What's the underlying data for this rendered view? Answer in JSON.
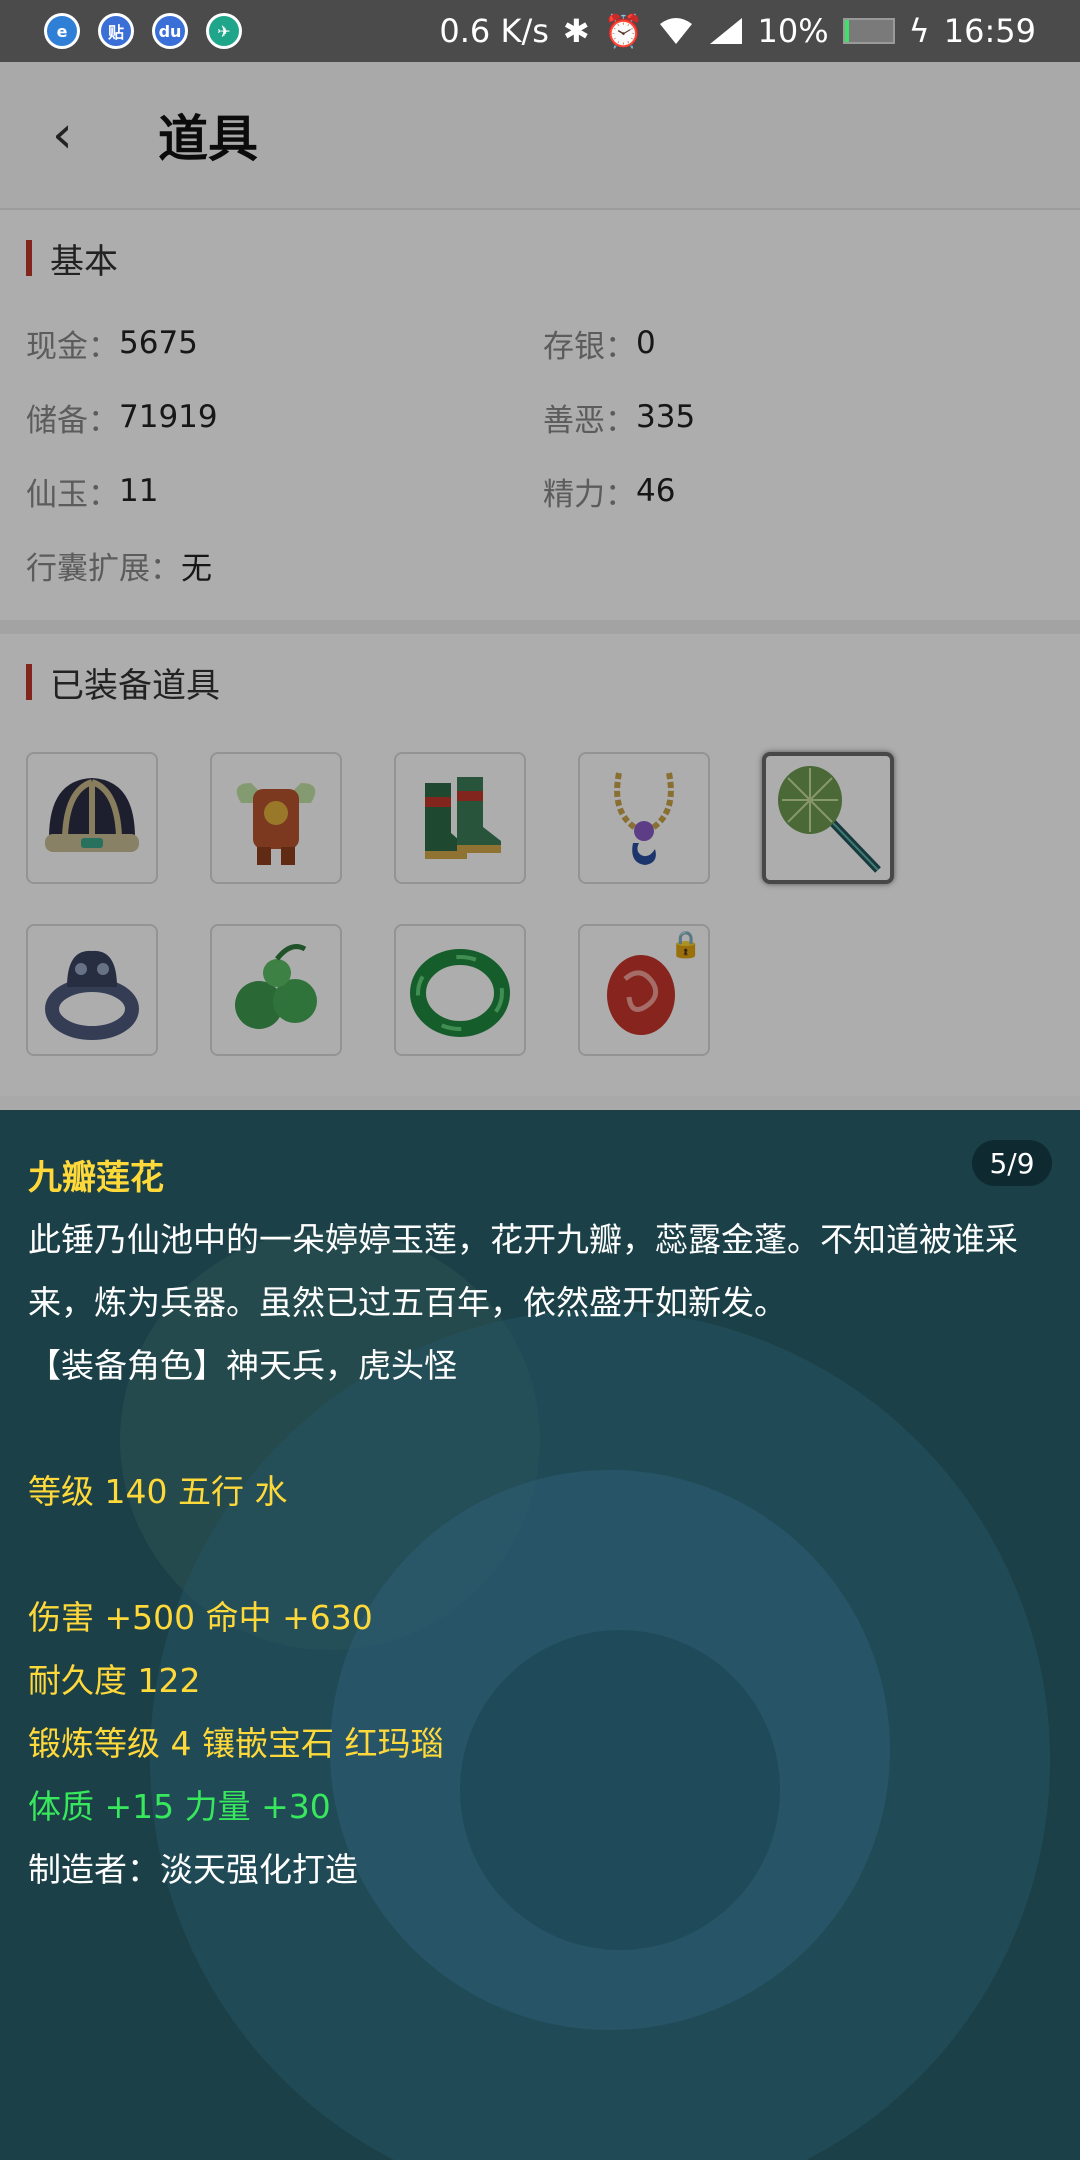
{
  "status_bar": {
    "net_speed": "0.6 K/s",
    "battery": "10%",
    "time": "16:59",
    "battery_level": 0.1,
    "app_badges": [
      "e",
      "贴",
      "du",
      "✈"
    ]
  },
  "header": {
    "title": "道具"
  },
  "basic": {
    "section_title": "基本",
    "cash_label": "现金：",
    "cash_value": "5675",
    "deposit_label": "存银：",
    "deposit_value": "0",
    "reserve_label": "储备：",
    "reserve_value": "71919",
    "karma_label": "善恶：",
    "karma_value": "335",
    "jade_label": "仙玉：",
    "jade_value": "11",
    "energy_label": "精力：",
    "energy_value": "46",
    "bag_label": "行囊扩展：",
    "bag_value": "无"
  },
  "equipped": {
    "section_title": "已装备道具",
    "items": [
      "helmet-icon",
      "armor-icon",
      "boots-icon",
      "necklace-icon",
      "lotus-hammer-icon",
      "ring-icon",
      "gourd-icon",
      "jade-bracelet-icon",
      "red-agate-icon"
    ],
    "selected_index": 4
  },
  "detail": {
    "name": "九瓣莲花",
    "pager": "5/9",
    "lines": [
      {
        "text": "此锤乃仙池中的一朵婷婷玉莲，花开九瓣，蕊露金蓬。不知道被谁采来，炼为兵器。虽然已过五百年，依然盛开如新发。",
        "color": "white"
      },
      {
        "text": "【装备角色】神天兵，虎头怪",
        "color": "white"
      },
      {
        "text": "",
        "color": "white"
      },
      {
        "text": "等级 140 五行 水",
        "color": "yellow"
      },
      {
        "text": "",
        "color": "white"
      },
      {
        "text": "伤害 +500 命中 +630",
        "color": "yellow"
      },
      {
        "text": "耐久度 122",
        "color": "yellow"
      },
      {
        "text": "锻炼等级 4 镶嵌宝石 红玛瑙",
        "color": "yellow"
      },
      {
        "text": "体质 +15 力量 +30",
        "color": "green"
      },
      {
        "text": "制造者：淡天强化打造",
        "color": "white"
      }
    ]
  },
  "colors": {
    "accent_bar": "#c0392b",
    "detail_bg": "#1b4048",
    "yellow_text": "#ffd83a",
    "green_text": "#37e85c"
  }
}
